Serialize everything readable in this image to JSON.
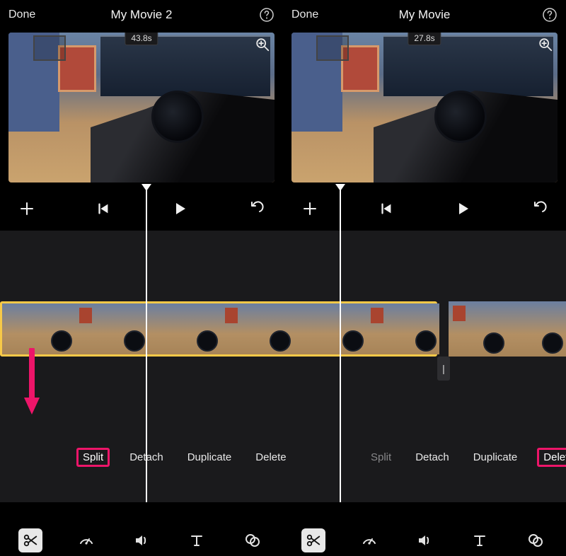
{
  "left": {
    "done": "Done",
    "title": "My Movie 2",
    "timestamp": "43.8s",
    "actions": {
      "split": "Split",
      "detach": "Detach",
      "duplicate": "Duplicate",
      "delete": "Delete"
    }
  },
  "right": {
    "done": "Done",
    "title": "My Movie",
    "timestamp": "27.8s",
    "actions": {
      "split": "Split",
      "detach": "Detach",
      "duplicate": "Duplicate",
      "delete": "Delete"
    }
  },
  "highlight": {
    "left": "split",
    "right": "delete"
  },
  "colors": {
    "accent": "#ed1569",
    "clip_selected": "#f7c948"
  }
}
